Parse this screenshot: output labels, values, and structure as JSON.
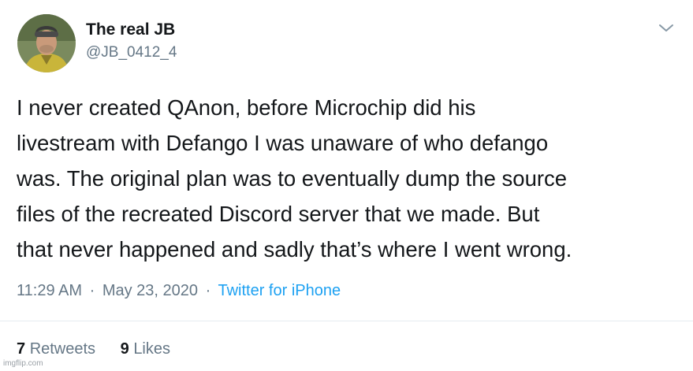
{
  "author": {
    "display_name": "The real JB",
    "handle": "@JB_0412_4"
  },
  "menu_icon": "chevron-down-icon",
  "tweet": {
    "lines": [
      "I never created QAnon, before Microchip did his",
      "livestream with Defango I was unaware of who defango",
      "was. The original plan was to eventually dump the source",
      "files of the recreated Discord server that we made. But",
      "that never happened and sadly that’s where I went wrong."
    ],
    "time": "11:29 AM",
    "separator": "·",
    "date": "May 23, 2020",
    "source": "Twitter for iPhone"
  },
  "stats": {
    "retweets_count": "7",
    "retweets_label": "Retweets",
    "likes_count": "9",
    "likes_label": "Likes"
  },
  "watermark": "imgflip.com",
  "colors": {
    "text": "#14171a",
    "secondary": "#657786",
    "link": "#1da1f2",
    "divider": "#e6ecf0"
  }
}
